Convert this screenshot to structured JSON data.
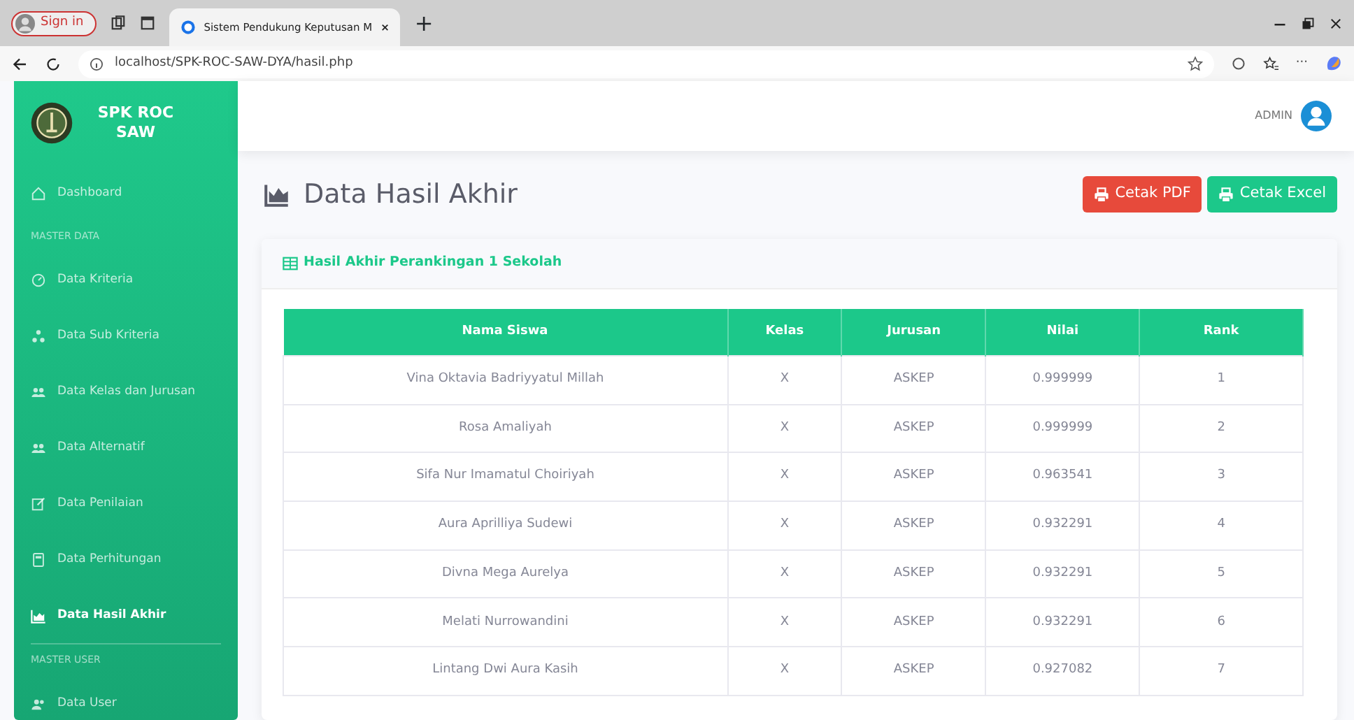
{
  "browser": {
    "sign_in": "Sign in",
    "tab_title": "Sistem Pendukung Keputusan M",
    "tab_close": "×",
    "new_tab": "+",
    "url": "localhost/SPK-ROC-SAW-DYA/hasil.php",
    "more": "···"
  },
  "sidebar": {
    "brand": "SPK ROC SAW",
    "items": [
      {
        "kind": "link",
        "label": "Dashboard",
        "selected": false
      },
      {
        "kind": "heading",
        "label": "MASTER DATA"
      },
      {
        "kind": "link",
        "label": "Data Kriteria",
        "selected": false
      },
      {
        "kind": "link",
        "label": "Data Sub Kriteria",
        "selected": false
      },
      {
        "kind": "link",
        "label": "Data Kelas dan Jurusan",
        "selected": false
      },
      {
        "kind": "link",
        "label": "Data Alternatif",
        "selected": false
      },
      {
        "kind": "link",
        "label": "Data Penilaian",
        "selected": false
      },
      {
        "kind": "link",
        "label": "Data Perhitungan",
        "selected": false
      },
      {
        "kind": "link",
        "label": "Data Hasil Akhir",
        "selected": true
      },
      {
        "kind": "divider"
      },
      {
        "kind": "heading",
        "label": "MASTER USER"
      },
      {
        "kind": "link",
        "label": "Data User",
        "selected": false
      }
    ]
  },
  "topbar": {
    "user": "ADMIN"
  },
  "page_title": "Data Hasil Akhir",
  "buttons": [
    {
      "kind": "pdf",
      "label": "Cetak PDF"
    },
    {
      "kind": "excel",
      "label": "Cetak Excel"
    }
  ],
  "card": {
    "title": "Hasil Akhir Perankingan 1 Sekolah",
    "table": {
      "columns": [
        "Nama Siswa",
        "Kelas",
        "Jurusan",
        "Nilai",
        "Rank"
      ],
      "rows": [
        [
          "Vina Oktavia Badriyyatul Millah",
          "X",
          "ASKEP",
          "0.999999",
          "1"
        ],
        [
          "Rosa Amaliyah",
          "X",
          "ASKEP",
          "0.999999",
          "2"
        ],
        [
          "Sifa Nur Imamatul Choiriyah",
          "X",
          "ASKEP",
          "0.963541",
          "3"
        ],
        [
          "Aura Aprilliya Sudewi",
          "X",
          "ASKEP",
          "0.932291",
          "4"
        ],
        [
          "Divna Mega Aurelya",
          "X",
          "ASKEP",
          "0.932291",
          "5"
        ],
        [
          "Melati Nurrowandini",
          "X",
          "ASKEP",
          "0.932291",
          "6"
        ],
        [
          "Lintang Dwi Aura Kasih",
          "X",
          "ASKEP",
          "0.927082",
          "7"
        ]
      ]
    }
  }
}
